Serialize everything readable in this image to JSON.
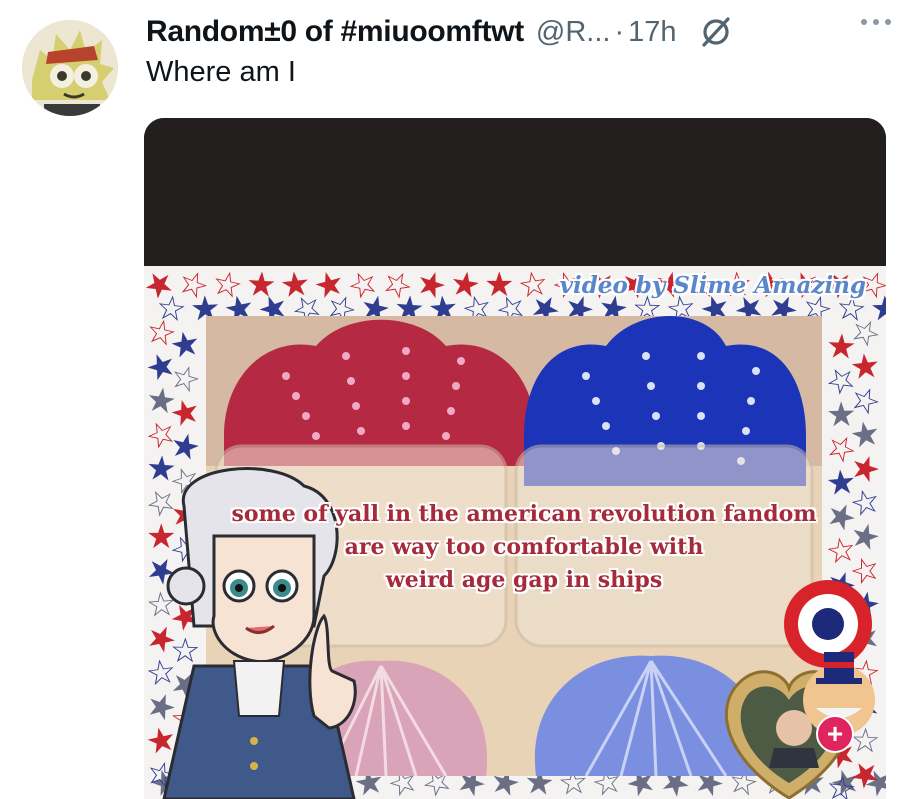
{
  "tweet": {
    "display_name": "Random±0 of #miuoomftwt",
    "handle": "@R...",
    "separator": "·",
    "time": "17h",
    "text": "Where am I"
  },
  "media": {
    "watermark": "video by Slime Amazing",
    "caption_lines": [
      "some of yall in the american revolution fandom",
      "are way too comfortable with",
      "weird age gap in ships"
    ],
    "overlay_button_symbol": "+"
  },
  "colors": {
    "name_text": "#0f1419",
    "meta_text": "#536471",
    "caption_red": "#a52a3a",
    "watermark_blue": "#5a87c9",
    "star_red": "#c8262f",
    "star_blue": "#2e3d8f",
    "slime_red": "#b52a42",
    "slime_blue": "#1c34b8"
  },
  "icons": [
    "grok-icon",
    "more-icon",
    "plus-icon"
  ]
}
